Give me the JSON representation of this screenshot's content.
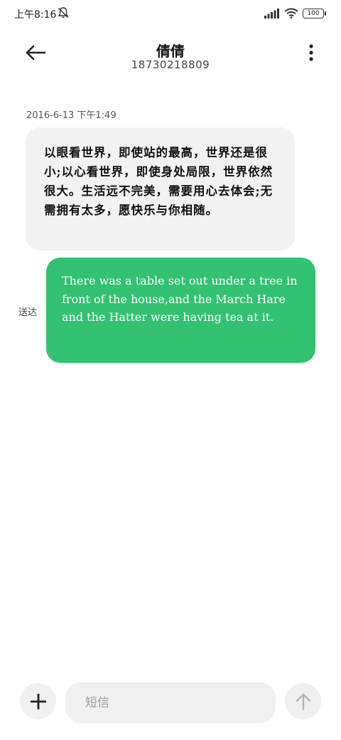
{
  "status_bar": {
    "time": "上午8:16",
    "battery": "100",
    "icons": [
      "mute-icon",
      "signal-icon",
      "wifi-icon",
      "battery-icon"
    ]
  },
  "header": {
    "contact_name": "倩倩",
    "contact_number": "18730218809",
    "icons": [
      "back-arrow-icon",
      "more-vertical-icon"
    ]
  },
  "conversation": {
    "timestamp": "2016-6-13 下午1:49",
    "incoming_message": "以眼看世界，即使站的最高，世界还是很小;以心看世界，即使身处局限，世界依然很大。生活远不完美，需要用心去体会;无需拥有太多，愿快乐与你相随。",
    "outgoing_message": "There was a table set out under a tree in front of the house,and the March Hare and the Hatter were having tea at it.",
    "outgoing_status": "送达"
  },
  "compose": {
    "placeholder": "短信",
    "value": "",
    "icons": [
      "plus-icon",
      "send-arrow-up-icon"
    ]
  },
  "colors": {
    "outgoing_bubble": "#33c172",
    "incoming_bubble": "#f2f2f2",
    "background": "#ffffff"
  }
}
